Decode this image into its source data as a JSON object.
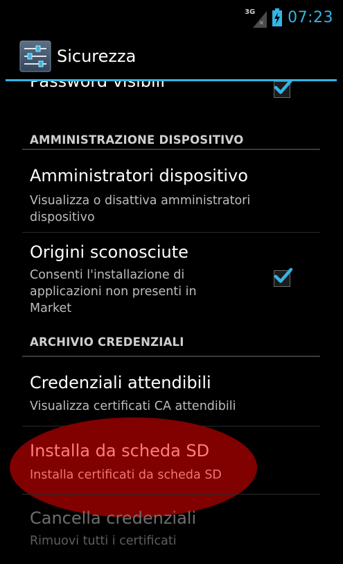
{
  "status": {
    "network": "3G",
    "time": "07:23",
    "accent": "#33b5e5"
  },
  "action_bar": {
    "title": "Sicurezza",
    "icon": "settings-sliders-icon"
  },
  "list": {
    "partial_item": {
      "title": "Password visibili",
      "checked": true
    },
    "section_admin": "AMMINISTRAZIONE DISPOSITIVO",
    "admins": {
      "title": "Amministratori dispositivo",
      "sub1": "Visualizza o disattiva amministratori",
      "sub2": "dispositivo"
    },
    "unknown_sources": {
      "title": "Origini sconosciute",
      "sub1": "Consenti l'installazione di",
      "sub2": "applicazioni non presenti in",
      "sub3": "Market",
      "checked": true
    },
    "section_credentials": "ARCHIVIO CREDENZIALI",
    "trusted": {
      "title": "Credenziali attendibili",
      "sub": "Visualizza certificati CA attendibili"
    },
    "install_sd": {
      "title": "Installa da scheda SD",
      "sub": "Installa certificati da scheda SD",
      "highlight_color": "#8c0000"
    },
    "clear": {
      "title": "Cancella credenziali",
      "sub": "Rimuovi tutti i certificati",
      "enabled": false
    }
  }
}
